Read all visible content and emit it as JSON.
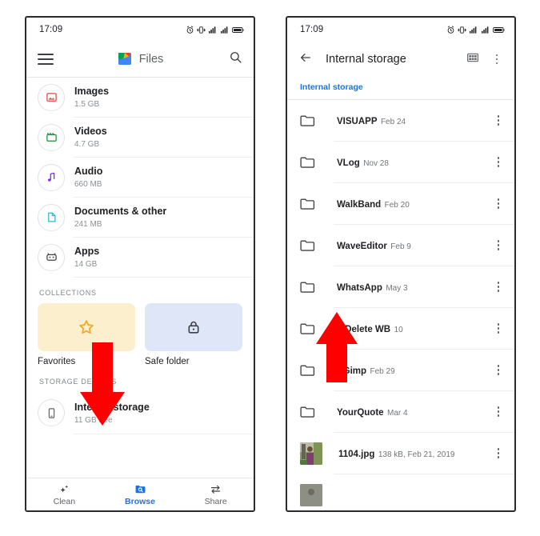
{
  "meta": {
    "accent_blue": "#1a73e8",
    "arrow_color": "#fe0000",
    "text_primary": "#202124",
    "text_secondary": "#70757a"
  },
  "left_phone": {
    "status": {
      "time": "17:09",
      "icons": [
        "alarm-icon",
        "vibrate-icon",
        "signal-icon",
        "signal-icon",
        "battery-icon"
      ]
    },
    "appbar": {
      "menu_icon": "hamburger-icon",
      "logo": "files-logo",
      "title": "Files",
      "search_icon": "search-icon"
    },
    "categories": [
      {
        "title": "Images",
        "size": "1.5 GB",
        "icon": "image-icon",
        "color": "#e8453c"
      },
      {
        "title": "Videos",
        "size": "4.7 GB",
        "icon": "video-icon",
        "color": "#1e8e3e"
      },
      {
        "title": "Audio",
        "size": "660 MB",
        "icon": "audio-icon",
        "color": "#7c2ae8"
      },
      {
        "title": "Documents & other",
        "size": "241 MB",
        "icon": "document-icon",
        "color": "#2ab7e0"
      },
      {
        "title": "Apps",
        "size": "14 GB",
        "icon": "apps-icon",
        "color": "#3c4043"
      }
    ],
    "collections": {
      "label": "COLLECTIONS",
      "cards": [
        {
          "label": "Favorites",
          "icon": "star-icon",
          "bg": "#fcefcd",
          "icon_color": "#f5a623"
        },
        {
          "label": "Safe folder",
          "icon": "lock-icon",
          "bg": "#dfe6f8",
          "icon_color": "#3c4043"
        }
      ]
    },
    "storage": {
      "label": "STORAGE DEVICES",
      "device": {
        "title": "Internal storage",
        "sub": "11 GB free",
        "icon": "phone-icon"
      }
    },
    "bottom_nav": [
      {
        "label": "Clean",
        "icon": "sparkle-icon",
        "active": false
      },
      {
        "label": "Browse",
        "icon": "browse-icon",
        "active": true
      },
      {
        "label": "Share",
        "icon": "share-icon",
        "active": false
      }
    ]
  },
  "right_phone": {
    "status": {
      "time": "17:09",
      "icons": [
        "alarm-icon",
        "vibrate-icon",
        "signal-icon",
        "signal-icon",
        "battery-icon"
      ]
    },
    "appbar": {
      "back_icon": "back-arrow-icon",
      "title": "Internal storage",
      "grid_icon": "grid-view-icon",
      "overflow_icon": "overflow-menu-icon"
    },
    "breadcrumb": "Internal storage",
    "files": [
      {
        "name": "VISUAPP",
        "sub": "Feb 24",
        "type": "folder"
      },
      {
        "name": "VLog",
        "sub": "Nov 28",
        "type": "folder"
      },
      {
        "name": "WalkBand",
        "sub": "Feb 20",
        "type": "folder"
      },
      {
        "name": "WaveEditor",
        "sub": "Feb 9",
        "type": "folder"
      },
      {
        "name": "WhatsApp",
        "sub": "May 3",
        "type": "folder"
      },
      {
        "name": "tsDelete WB",
        "sub": "10",
        "type": "folder"
      },
      {
        "name": "XGimp",
        "sub": "Feb 29",
        "type": "folder"
      },
      {
        "name": "YourQuote",
        "sub": "Mar 4",
        "type": "folder"
      },
      {
        "name": "1104.jpg",
        "sub": "138 kB, Feb 21, 2019",
        "type": "image"
      }
    ]
  },
  "annotations": [
    {
      "name": "down-arrow-to-internal-storage",
      "direction": "down"
    },
    {
      "name": "up-arrow-to-whatsapp-folder",
      "direction": "up"
    }
  ]
}
